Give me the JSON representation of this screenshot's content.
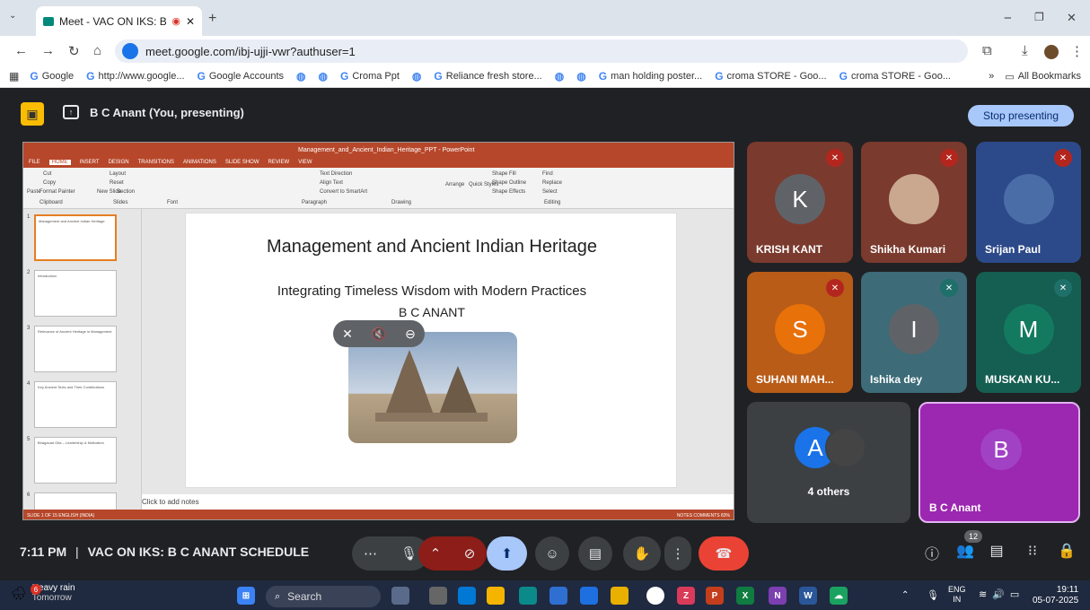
{
  "browser": {
    "tab_title": "Meet - VAC ON IKS: B C AN",
    "new_tab": "+",
    "url": "meet.google.com/ibj-ujji-vwr?authuser=1",
    "bookmarks": [
      "Google",
      "http://www.google...",
      "Google Accounts",
      "",
      "",
      "Croma Ppt",
      "",
      "Reliance fresh store...",
      "",
      "",
      "man holding poster...",
      "croma STORE - Goo...",
      "croma STORE - Goo..."
    ],
    "more_bookmarks": "»",
    "all_bookmarks": "All Bookmarks"
  },
  "meet": {
    "presenter_label": "B C Anant (You, presenting)",
    "stop_presenting": "Stop presenting",
    "time": "7:11 PM",
    "separator": "|",
    "meeting_title": "VAC ON IKS: B C ANANT SCHEDULE",
    "participant_count": "12"
  },
  "ppt": {
    "window_title": "Management_and_Ancient_Indian_Heritage_PPT - PowerPoint",
    "tabs": [
      "FILE",
      "HOME",
      "INSERT",
      "DESIGN",
      "TRANSITIONS",
      "ANIMATIONS",
      "SLIDE SHOW",
      "REVIEW",
      "VIEW"
    ],
    "ribbon_groups": [
      "Clipboard",
      "Slides",
      "Font",
      "Paragraph",
      "Drawing",
      "Editing"
    ],
    "ribbon_labels": [
      "Cut",
      "Copy",
      "Format Painter",
      "Paste",
      "Layout",
      "Reset",
      "New Slide",
      "Section",
      "Text Direction",
      "Align Text",
      "Convert to SmartArt",
      "Arrange",
      "Quick Styles",
      "Shape Fill",
      "Shape Outline",
      "Shape Effects",
      "Find",
      "Replace",
      "Select"
    ],
    "slide_title": "Management and Ancient Indian Heritage",
    "slide_subtitle": "Integrating Timeless Wisdom with Modern Practices",
    "slide_author": "B C ANANT",
    "notes_placeholder": "Click to add notes",
    "status_left": "SLIDE 1 OF 15    ENGLISH (INDIA)",
    "status_right": "NOTES   COMMENTS   83%",
    "thumbnails": [
      {
        "num": "1",
        "title": "Management and Ancient Indian Heritage"
      },
      {
        "num": "2",
        "title": "Introduction"
      },
      {
        "num": "3",
        "title": "Relevance of Ancient Heritage in Management"
      },
      {
        "num": "4",
        "title": "Key Ancient Texts and Their Contributions"
      },
      {
        "num": "5",
        "title": "Bhagavad Gita – Leadership & Motivation"
      },
      {
        "num": "6",
        "title": ""
      }
    ]
  },
  "participants": [
    {
      "initial": "K",
      "name": "KRISH KANT",
      "color": "#5f6368",
      "tile": "#7a3a2d"
    },
    {
      "initial": "",
      "name": "Shikha Kumari",
      "color": "#c9a88f",
      "tile": "#7a3a2d"
    },
    {
      "initial": "",
      "name": "Srijan Paul",
      "color": "#4a6da8",
      "tile": "#2c4a8a"
    },
    {
      "initial": "S",
      "name": "SUHANI MAH...",
      "color": "#e8710a",
      "tile": "#b85c18"
    },
    {
      "initial": "I",
      "name": "Ishika dey",
      "color": "#5f6368",
      "tile": "#3d6b78"
    },
    {
      "initial": "M",
      "name": "MUSKAN KU...",
      "color": "#137a5f",
      "tile": "#155e52"
    },
    {
      "initial": "A",
      "name": "4 others",
      "color": "#1a73e8",
      "tile": "#3c4043"
    },
    {
      "initial": "B",
      "name": "B C Anant",
      "color": "#a142c4",
      "tile": "#9c27b0"
    }
  ],
  "taskbar": {
    "weather": "Heavy rain",
    "weather_sub": "Tomorrow",
    "weather_badge": "6",
    "search": "Search",
    "lang": "ENG",
    "lang_sub": "IN",
    "clock": "19:11",
    "date": "05-07-2025"
  },
  "colors": {
    "meet_bg": "#202124",
    "stop_btn": "#a8c7fa",
    "end_call": "#ea4335",
    "ppt_accent": "#b7472a"
  }
}
